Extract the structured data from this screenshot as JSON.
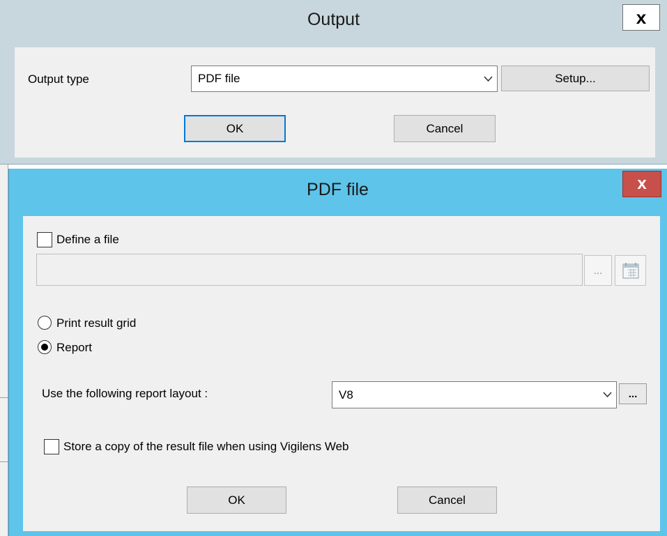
{
  "output_dialog": {
    "title": "Output",
    "close_glyph": "x",
    "output_type_label": "Output type",
    "output_type_value": "PDF file",
    "setup_label": "Setup...",
    "ok_label": "OK",
    "cancel_label": "Cancel"
  },
  "pdf_dialog": {
    "title": "PDF file",
    "close_glyph": "x",
    "define_file_label": "Define a file",
    "define_file_checked": false,
    "file_path_value": "",
    "browse_label": "...",
    "print_result_grid_label": "Print result grid",
    "report_label": "Report",
    "selected_option": "Report",
    "report_layout_label": "Use the following report layout :",
    "report_layout_value": "V8",
    "report_layout_browse_label": "...",
    "store_copy_label": "Store a copy of the result file when using Vigilens Web",
    "store_copy_checked": false,
    "ok_label": "OK",
    "cancel_label": "Cancel"
  },
  "icons": {
    "combo_arrow": "chevron-down-icon",
    "calendar": "calendar-icon"
  },
  "colors": {
    "pdf_title_bar": "#5ec4ea",
    "pdf_close_button": "#c7504a",
    "output_title_bar": "#c8d7de",
    "default_button_border": "#0078d7"
  }
}
